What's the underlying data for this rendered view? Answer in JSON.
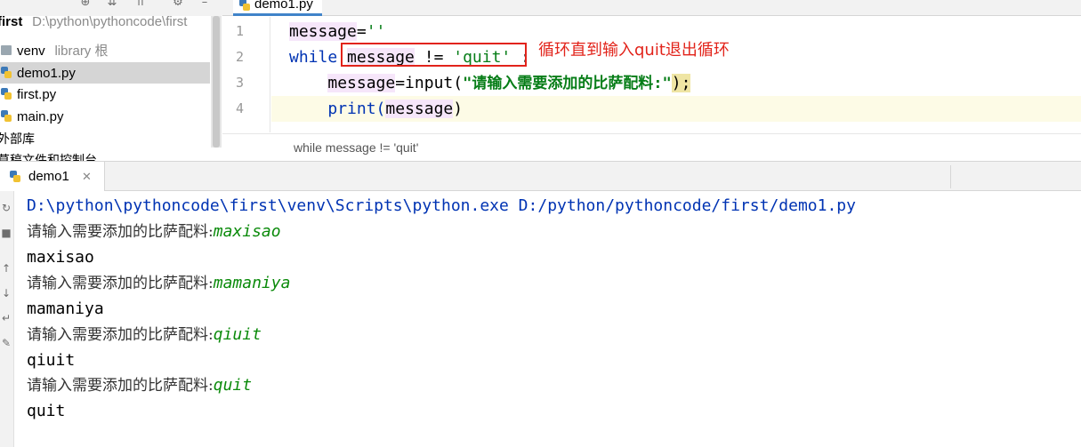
{
  "project_tree": {
    "root_name": "first",
    "root_path": "D:\\python\\pythoncode\\first",
    "items": [
      {
        "name": "venv",
        "hint": "library 根",
        "type": "folder"
      },
      {
        "name": "demo1.py",
        "hint": "",
        "type": "py"
      },
      {
        "name": "first.py",
        "hint": "",
        "type": "py"
      },
      {
        "name": "main.py",
        "hint": "",
        "type": "py"
      }
    ],
    "external_libraries": "外部库",
    "scratches": "草稿文件和控制台"
  },
  "editor": {
    "tab_label": "demo1.py",
    "line_numbers": [
      "1",
      "2",
      "3",
      "4"
    ],
    "line1": {
      "var": "message",
      "op": "=",
      "str": "''"
    },
    "line2": {
      "kw": "while",
      "var": "message",
      "op": " != ",
      "str": "'quit'",
      "end": ":"
    },
    "line3": {
      "indent": "    ",
      "var": "message",
      "op": "=input(",
      "str": "\"请输入需要添加的比萨配料:\"",
      "end": ");"
    },
    "line4": {
      "indent": "    ",
      "fn": "print(",
      "var": "message",
      "end": ")"
    },
    "annotation": "循环直到输入quit退出循环"
  },
  "breadcrumb": "while message != 'quit'",
  "run_panel": {
    "tab_label": "demo1",
    "command": "D:\\python\\pythoncode\\first\\venv\\Scripts\\python.exe D:/python/pythoncode/first/demo1.py",
    "prompt": "请输入需要添加的比萨配料:",
    "exchanges": [
      {
        "input": "maxisao",
        "output": "maxisao"
      },
      {
        "input": "mamaniya",
        "output": "mamaniya"
      },
      {
        "input": "qiuit",
        "output": "qiuit"
      },
      {
        "input": "quit",
        "output": "quit"
      }
    ]
  },
  "colors": {
    "keyword": "#0033b3",
    "string": "#067d17",
    "annotation": "#e2231a",
    "user_input": "#0a8a0a"
  }
}
